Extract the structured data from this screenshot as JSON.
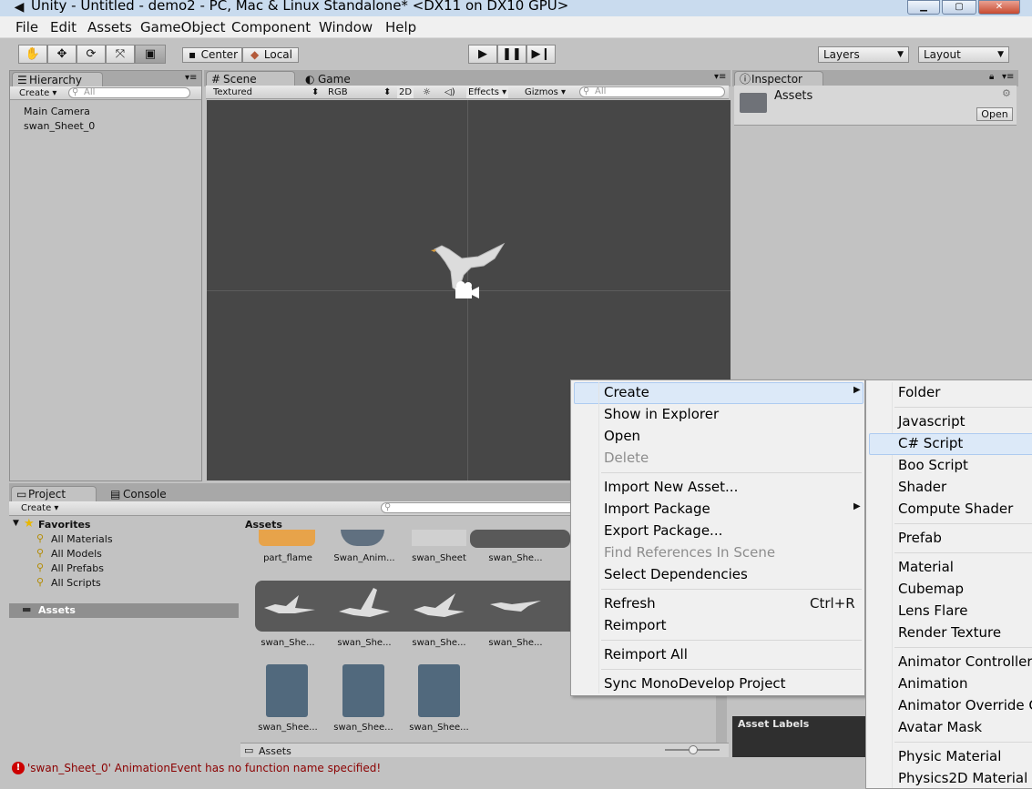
{
  "window": {
    "title": "Unity - Untitled - demo2 - PC, Mac & Linux Standalone* <DX11 on DX10 GPU>",
    "logo_icon": "unity-logo-icon",
    "controls": [
      "minimize-icon",
      "maximize-icon",
      "close-icon"
    ]
  },
  "menubar": [
    "File",
    "Edit",
    "Assets",
    "GameObject",
    "Component",
    "Window",
    "Help"
  ],
  "toolbar": {
    "pivot": "Center",
    "space": "Local",
    "layers": "Layers",
    "layout": "Layout"
  },
  "hierarchy": {
    "tab": "Hierarchy",
    "create": "Create",
    "search_placeholder": "All",
    "items": [
      "Main Camera",
      "swan_Sheet_0"
    ]
  },
  "scene": {
    "tab_scene": "Scene",
    "tab_game": "Game",
    "shading": "Textured",
    "render_mode": "RGB",
    "mode_2d": "2D",
    "effects": "Effects",
    "gizmos": "Gizmos",
    "search_placeholder": "All"
  },
  "inspector": {
    "tab": "Inspector",
    "title": "Assets",
    "open_button": "Open",
    "asset_labels": "Asset Labels"
  },
  "project": {
    "tab_project": "Project",
    "tab_console": "Console",
    "create": "Create",
    "favorites_label": "Favorites",
    "favorites": [
      "All Materials",
      "All Models",
      "All Prefabs",
      "All Scripts"
    ],
    "assets_folder": "Assets",
    "breadcrumb": "Assets",
    "footer_path": "Assets",
    "row1": [
      "part_flame",
      "Swan_Anim...",
      "swan_Sheet",
      "swan_She..."
    ],
    "row2": [
      "swan_She...",
      "swan_She...",
      "swan_She...",
      "swan_She..."
    ],
    "row3": [
      "swan_Shee...",
      "swan_Shee...",
      "swan_Shee..."
    ]
  },
  "status": {
    "message": "'swan_Sheet_0' AnimationEvent has no function name specified!"
  },
  "context_menu": {
    "create": "Create",
    "show_in_explorer": "Show in Explorer",
    "open": "Open",
    "delete": "Delete",
    "import_new_asset": "Import New Asset...",
    "import_package": "Import Package",
    "export_package": "Export Package...",
    "find_references": "Find References In Scene",
    "select_dependencies": "Select Dependencies",
    "refresh": "Refresh",
    "refresh_shortcut": "Ctrl+R",
    "reimport": "Reimport",
    "reimport_all": "Reimport All",
    "sync_monodevelop": "Sync MonoDevelop Project"
  },
  "create_submenu": {
    "folder": "Folder",
    "javascript": "Javascript",
    "csharp_script": "C# Script",
    "boo_script": "Boo Script",
    "shader": "Shader",
    "compute_shader": "Compute Shader",
    "prefab": "Prefab",
    "material": "Material",
    "cubemap": "Cubemap",
    "lens_flare": "Lens Flare",
    "render_texture": "Render Texture",
    "animator_controller": "Animator Controller",
    "animation": "Animation",
    "animator_override": "Animator Override Co",
    "avatar_mask": "Avatar Mask",
    "physic_material": "Physic Material",
    "physics2d_material": "Physics2D Material"
  }
}
